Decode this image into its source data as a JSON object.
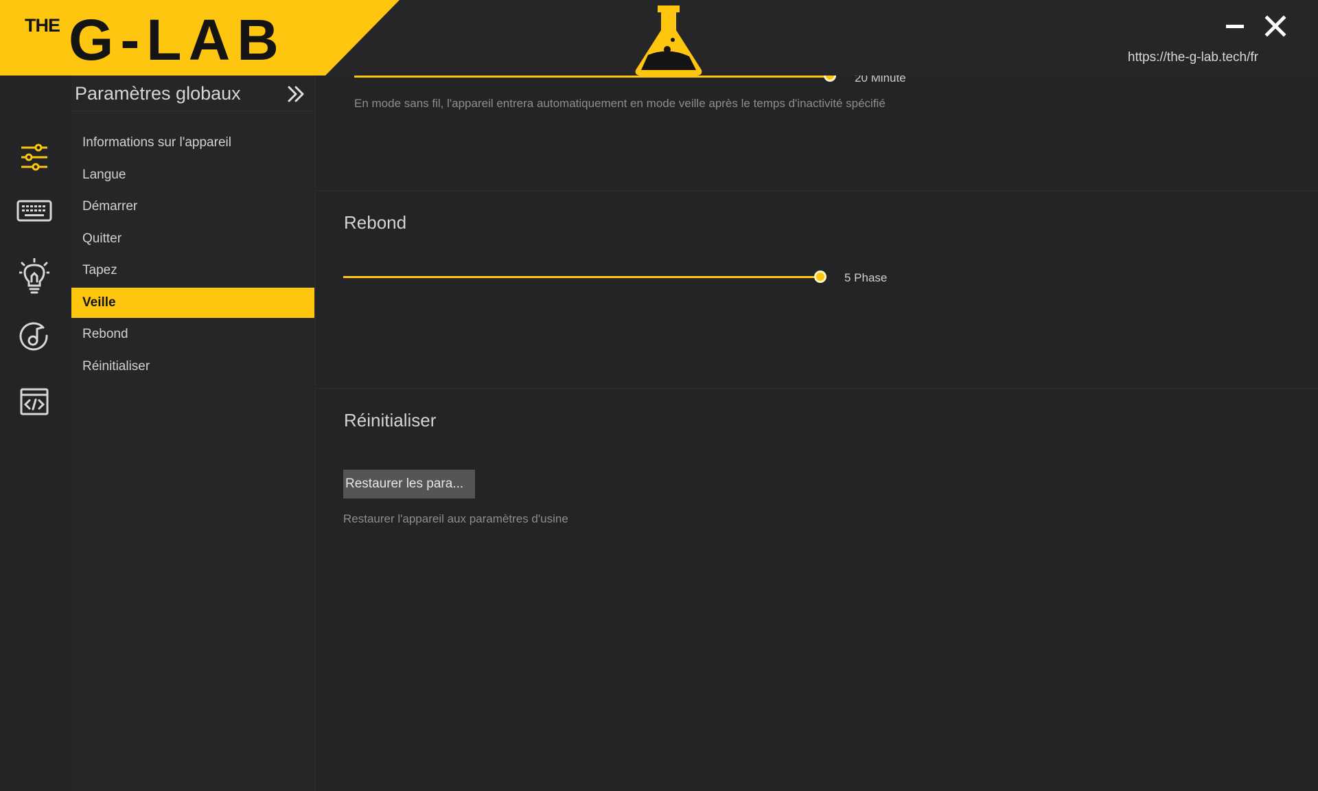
{
  "header": {
    "logo_small": "THE",
    "logo_text": "G-LAB",
    "url": "https://the-g-lab.tech/fr",
    "minimize_icon": "minimize-icon",
    "close_icon": "close-icon",
    "brand_color": "#fec60e"
  },
  "rail": {
    "icons": [
      "sliders-icon",
      "keyboard-icon",
      "lightbulb-icon",
      "music-note-icon",
      "code-window-icon"
    ]
  },
  "sidebar": {
    "title": "Paramètres globaux",
    "items": [
      {
        "label": "Informations sur l'appareil"
      },
      {
        "label": "Langue"
      },
      {
        "label": "Démarrer"
      },
      {
        "label": "Quitter"
      },
      {
        "label": "Tapez"
      },
      {
        "label": "Veille",
        "active": true
      },
      {
        "label": "Rebond"
      },
      {
        "label": "Réinitialiser"
      }
    ]
  },
  "main": {
    "sleep": {
      "value_label": "20 Minute",
      "hint": "En mode sans fil, l'appareil entrera automatiquement en mode veille après le temps d'inactivité spécifié",
      "level": 1.0
    },
    "debounce": {
      "title": "Rebond",
      "value_label": "5 Phase",
      "level": 1.0
    },
    "reset": {
      "title": "Réinitialiser",
      "button_label": "Restaurer les para...",
      "hint": "Restaurer l'appareil aux paramètres d'usine"
    }
  }
}
